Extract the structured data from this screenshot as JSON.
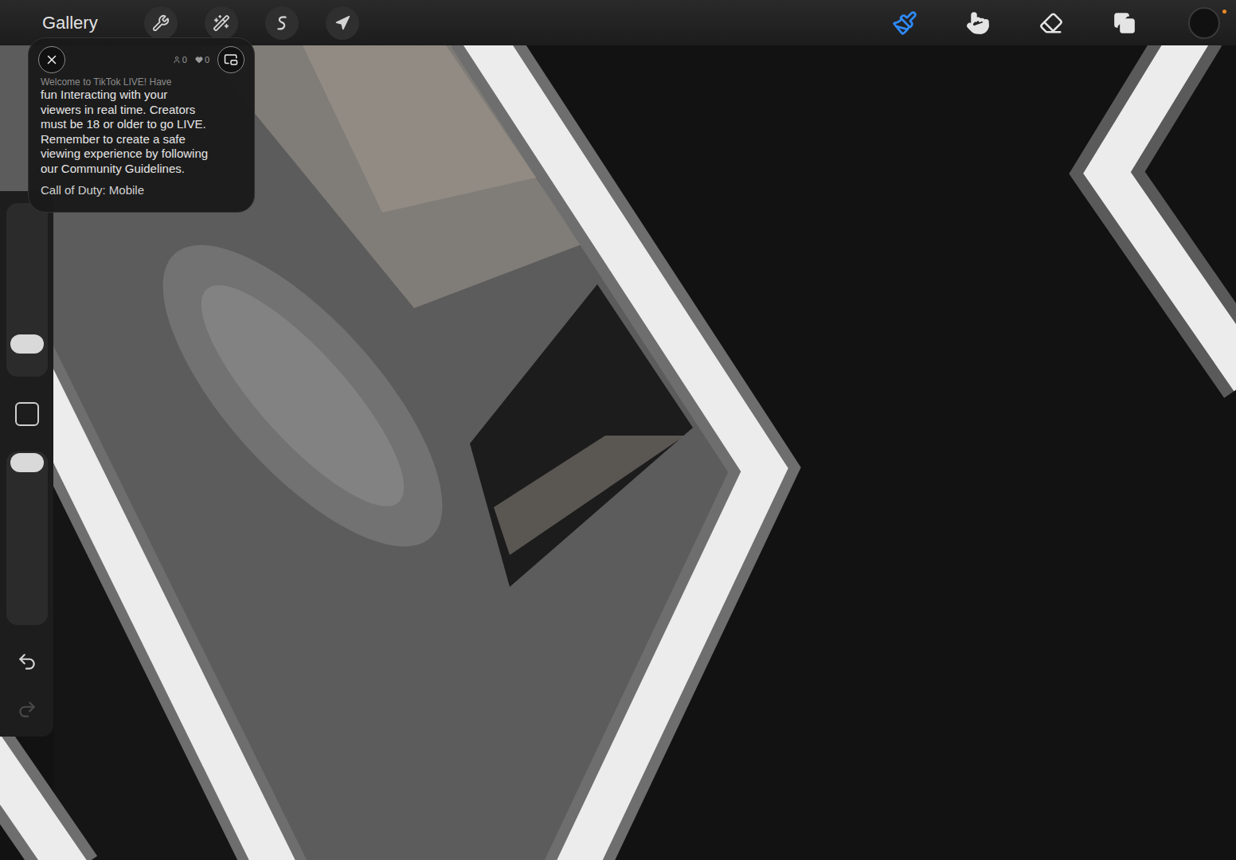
{
  "toolbar": {
    "gallery": "Gallery",
    "left_tools": [
      {
        "name": "actions",
        "selected": false
      },
      {
        "name": "adjustments",
        "selected": false
      },
      {
        "name": "selection",
        "selected": false
      },
      {
        "name": "transform",
        "selected": false
      }
    ],
    "right_tools": [
      {
        "name": "brush",
        "selected": true
      },
      {
        "name": "smudge",
        "selected": false
      },
      {
        "name": "eraser",
        "selected": false
      },
      {
        "name": "layers",
        "selected": false
      }
    ],
    "color": "#111111"
  },
  "sidebar": {
    "size_slider": {
      "level": 0.15
    },
    "opacity_slider": {
      "level": 0.99
    },
    "undo": {
      "disabled": false
    },
    "redo": {
      "disabled": true
    }
  },
  "live_overlay": {
    "viewers": "0",
    "likes": "0",
    "lines": [
      "Welcome to TikTok LIVE! Have",
      "fun Interacting with your",
      "viewers in real time. Creators",
      "must be 18 or older to go LIVE.",
      "Remember to create a safe",
      "viewing experience by following",
      "our Community Guidelines."
    ],
    "game": "Call of Duty: Mobile"
  }
}
